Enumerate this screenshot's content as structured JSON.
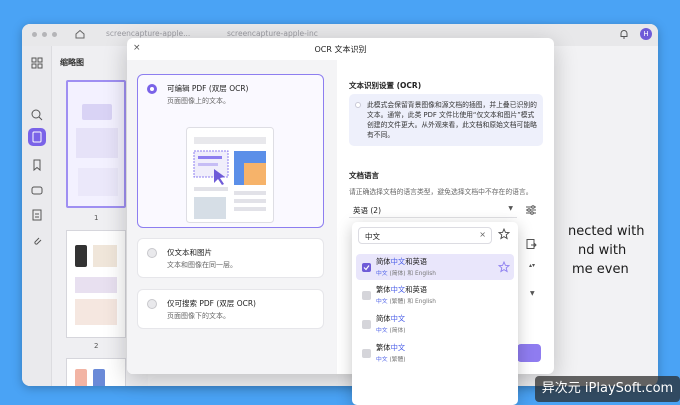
{
  "window": {
    "tab_ghost_1": "screencapture-apple...",
    "tab_ghost_2": "screencapture-apple-inc",
    "avatar_letter": "H"
  },
  "thumbnails": {
    "title": "缩略图",
    "pages": [
      "1",
      "2"
    ]
  },
  "document": {
    "lines": [
      "nected with",
      "nd with",
      "me even"
    ]
  },
  "dialog": {
    "title": "OCR 文本识别",
    "close": "×",
    "options": [
      {
        "label": "可编辑 PDF (双层 OCR)",
        "desc": "页面图像上的文本。",
        "selected": true
      },
      {
        "label": "仅文本和图片",
        "desc": "文本和图像在同一层。",
        "selected": false
      },
      {
        "label": "仅可搜索 PDF (双层 OCR)",
        "desc": "页面图像下的文本。",
        "selected": false
      }
    ],
    "settings_title": "文本识别设置 (OCR)",
    "info_text": "此模式会保留背景图像和源文档的插图，并上叠已识别的文本。通常，此类 PDF 文件比使用“仅文本和图片”模式创建的文件更大。从外观来看，此文档和原始文档可能略有不同。",
    "language_title": "文档语言",
    "language_hint": "请正确选择文档的语言类型，避免选择文档中不存在的语言。",
    "language_value": "英语 (2)"
  },
  "dropdown": {
    "search_value": "中文",
    "items": [
      {
        "pre": "简体",
        "hl": "中文",
        "post": "和英语",
        "sub_pre": "",
        "sub_hl": "中文",
        "sub_post": " (简体) 和 English",
        "checked": true
      },
      {
        "pre": "繁体",
        "hl": "中文",
        "post": "和英语",
        "sub_pre": "",
        "sub_hl": "中文",
        "sub_post": " (繁體) 和 English",
        "checked": false
      },
      {
        "pre": "简体",
        "hl": "中文",
        "post": "",
        "sub_pre": "",
        "sub_hl": "中文",
        "sub_post": " (简体)",
        "checked": false
      },
      {
        "pre": "繁体",
        "hl": "中文",
        "post": "",
        "sub_pre": "",
        "sub_hl": "中文",
        "sub_post": " (繁體)",
        "checked": false
      }
    ]
  },
  "watermark": "异次元 iPlaySoft.com",
  "colors": {
    "accent": "#7a63e8",
    "highlight": "#4a5ee8",
    "background": "#4aa3f5"
  }
}
